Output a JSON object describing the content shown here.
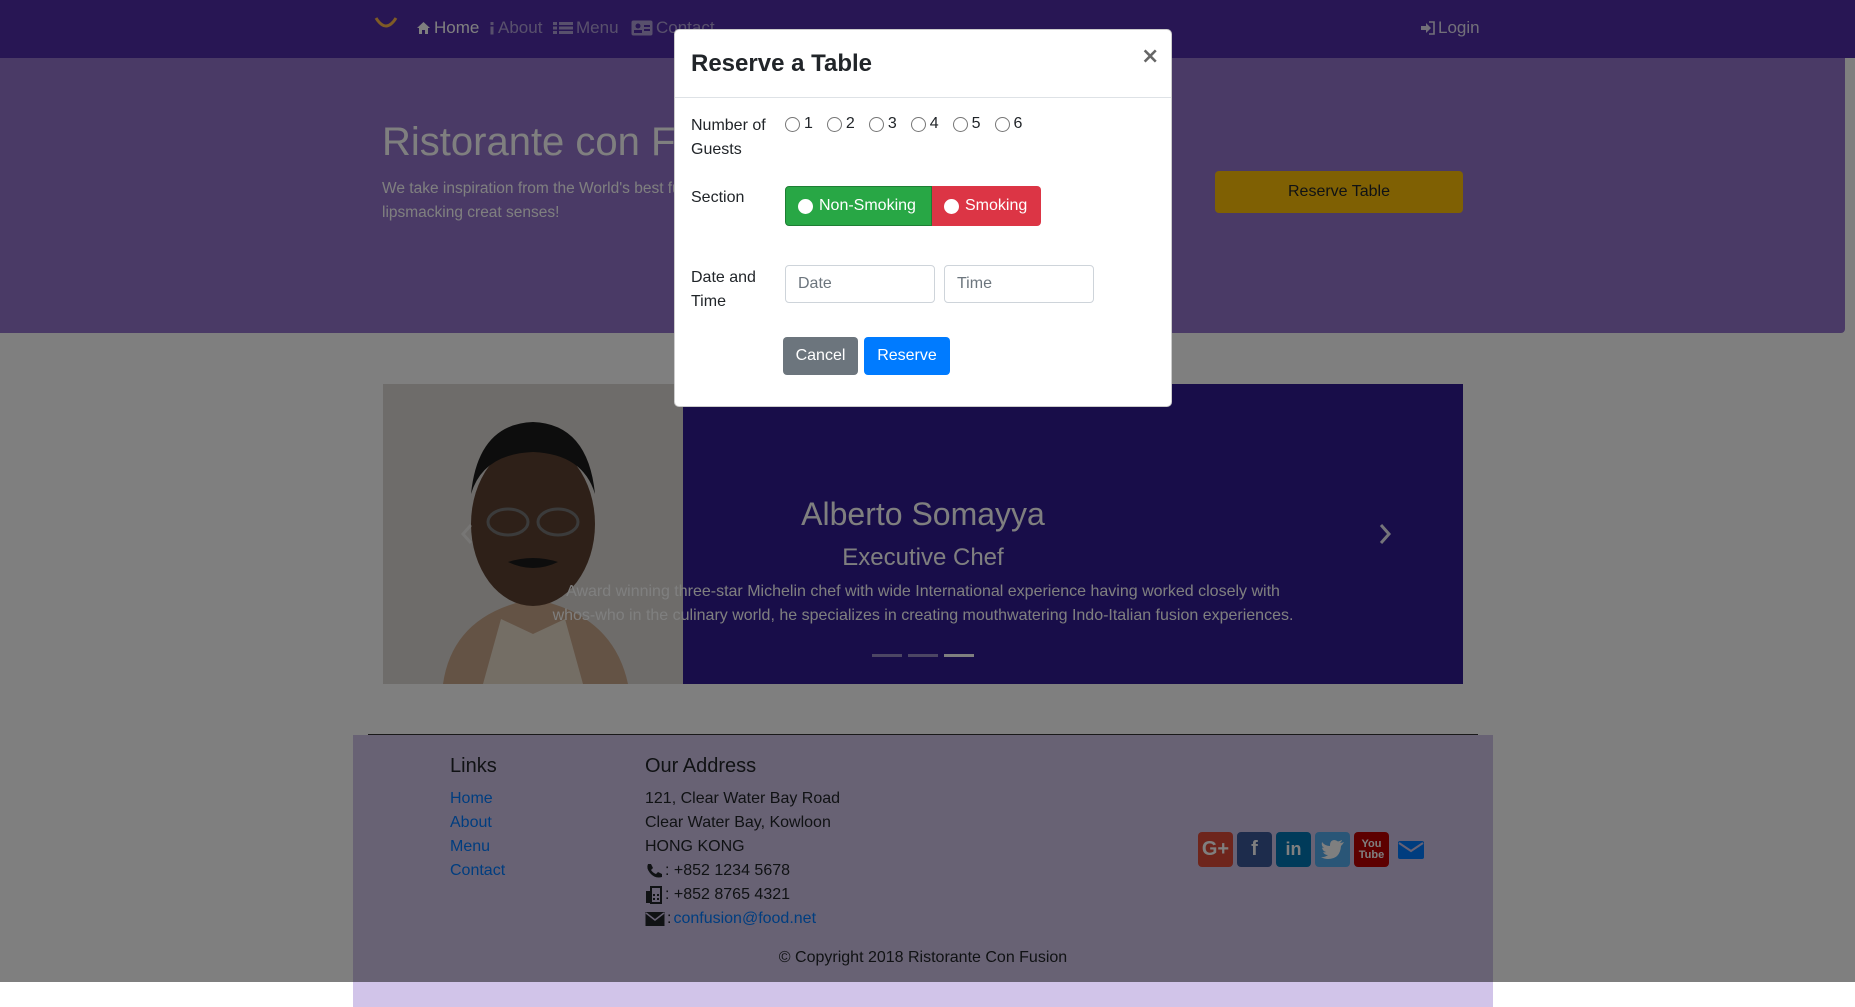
{
  "navbar": {
    "items": [
      {
        "label": "Home",
        "icon": "home-icon"
      },
      {
        "label": "About",
        "icon": "info-icon"
      },
      {
        "label": "Menu",
        "icon": "list-icon"
      },
      {
        "label": "Contact",
        "icon": "address-card-icon"
      }
    ],
    "login_label": "Login",
    "color": "#512da8"
  },
  "jumbotron": {
    "title": "Ristorante con F",
    "text": "We take inspiration from the World's best fusion experience. Our lipsmacking creat senses!",
    "reserve_label": "Reserve Table",
    "color": "#9575cd"
  },
  "carousel": {
    "name": "Alberto Somayya",
    "role": "Executive Chef",
    "description": "Award winning three-star Michelin chef with wide International experience having worked closely with whos-who in the culinary world, he specializes in creating mouthwatering Indo-Italian fusion experiences.",
    "indicators": 3,
    "active_indicator": 3
  },
  "footer": {
    "links_heading": "Links",
    "links": [
      "Home",
      "About",
      "Menu",
      "Contact"
    ],
    "address_heading": "Our Address",
    "address_lines": [
      "121, Clear Water Bay Road",
      "Clear Water Bay, Kowloon",
      "HONG KONG"
    ],
    "phone": ": +852 1234 5678",
    "fax": ": +852 8765 4321",
    "email_prefix": ":",
    "email": "confusion@food.net",
    "social": [
      "google-plus-icon",
      "facebook-icon",
      "linkedin-icon",
      "twitter-icon",
      "youtube-icon",
      "envelope-icon"
    ],
    "copyright": "© Copyright 2018 Ristorante Con Fusion"
  },
  "modal": {
    "title": "Reserve a Table",
    "close": "×",
    "guests_label": "Number of Guests",
    "guest_options": [
      "1",
      "2",
      "3",
      "4",
      "5",
      "6"
    ],
    "section_label": "Section",
    "section_options": [
      "Non-Smoking",
      "Smoking"
    ],
    "section_selected": "Non-Smoking",
    "datetime_label": "Date and Time",
    "date_placeholder": "Date",
    "time_placeholder": "Time",
    "cancel_label": "Cancel",
    "reserve_label": "Reserve"
  }
}
